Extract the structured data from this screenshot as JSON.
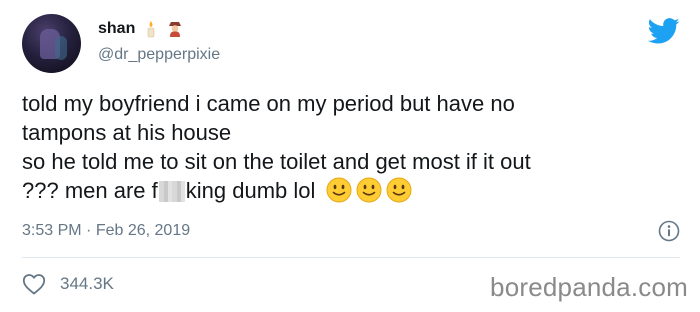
{
  "user": {
    "name": "shan",
    "handle": "@dr_pepperpixie",
    "emojis": [
      "candle-emoji",
      "woman-guard-emoji"
    ]
  },
  "tweet": {
    "line1": "told my boyfriend i came on my period but have no",
    "line2": "tampons at his house",
    "line3": "so he told me to sit on the toilet and get most if it out",
    "line4_pre": "??? men are f",
    "line4_post": "king dumb lol",
    "end_emojis": [
      "slightly-smiling-face-emoji",
      "slightly-smiling-face-emoji",
      "slightly-smiling-face-emoji"
    ]
  },
  "meta": {
    "time": "3:53 PM",
    "separator": "·",
    "date": "Feb 26, 2019"
  },
  "actions": {
    "like_count": "344.3K"
  },
  "watermark": "boredpanda.com",
  "colors": {
    "twitter_blue": "#1da1f2",
    "secondary_text": "#657786",
    "emoji_yellow": "#ffcc33"
  }
}
